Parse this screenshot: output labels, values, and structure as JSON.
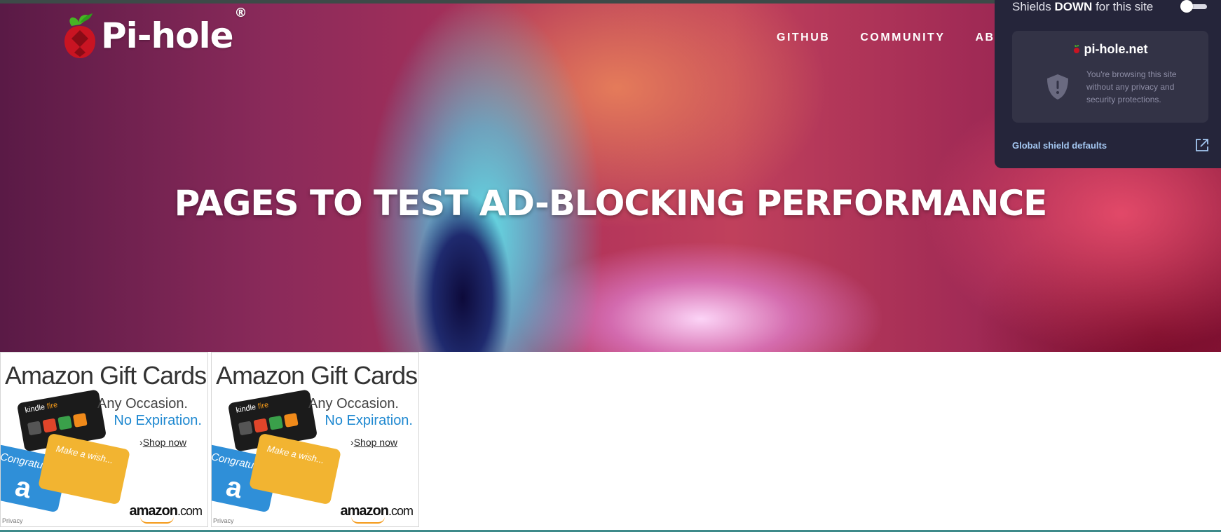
{
  "site": {
    "brand": "Pi-hole",
    "brand_mark": "®",
    "nav": [
      "GITHUB",
      "COMMUNITY",
      "AB"
    ],
    "hero_title": "PAGES TO TEST AD-BLOCKING PERFORMANCE"
  },
  "ads": [
    {
      "title": "Amazon Gift Cards",
      "line1": "Any Occasion.",
      "line2": "No Expiration.",
      "shop": "Shop now",
      "brand": "amazon",
      "brand_suffix": ".com",
      "privacy": "Privacy",
      "kindle": "kindle",
      "fire": "fire",
      "congrats": "Congratulat",
      "wish": "Make a wish..."
    },
    {
      "title": "Amazon Gift Cards",
      "line1": "Any Occasion.",
      "line2": "No Expiration.",
      "shop": "Shop now",
      "brand": "amazon",
      "brand_suffix": ".com",
      "privacy": "Privacy",
      "kindle": "kindle",
      "fire": "fire",
      "congrats": "Congratulat",
      "wish": "Make a wish..."
    }
  ],
  "shields": {
    "label_prefix": "Shields",
    "label_state": "DOWN",
    "label_suffix": "for this site",
    "enabled": false,
    "domain": "pi-hole.net",
    "description": "You're browsing this site without any privacy and security protections.",
    "global_defaults": "Global shield defaults"
  },
  "colors": {
    "panel_bg": "#25253a",
    "card_bg": "#333346",
    "link": "#a5c8f2",
    "amazon_blue": "#1e88d0"
  },
  "icons": [
    "pihole-logo-icon",
    "shield-icon",
    "external-link-icon",
    "chevron-right-icon"
  ]
}
